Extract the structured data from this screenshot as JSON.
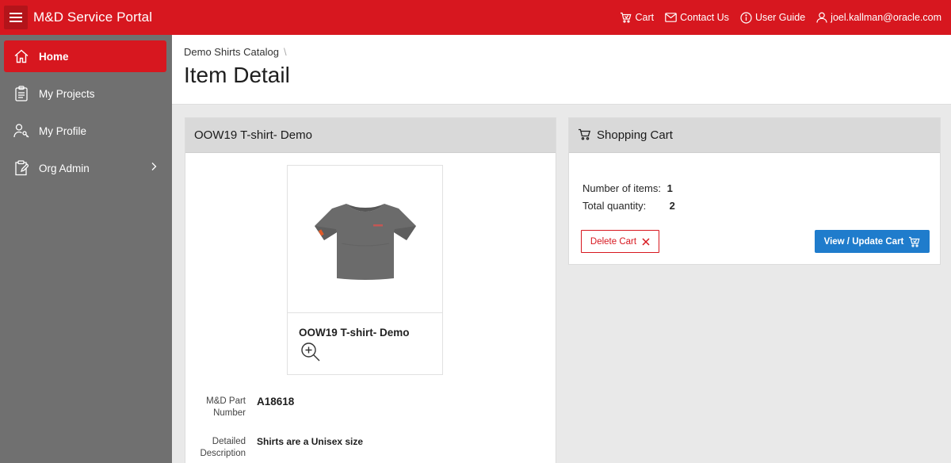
{
  "header": {
    "app_title": "M&D Service Portal",
    "nav": [
      {
        "label": "Cart",
        "icon": "cart-icon"
      },
      {
        "label": "Contact Us",
        "icon": "envelope-icon"
      },
      {
        "label": "User Guide",
        "icon": "info-icon"
      },
      {
        "label": "joel.kallman@oracle.com",
        "icon": "user-icon"
      }
    ],
    "brand_color": "#d7171f"
  },
  "sidebar": {
    "items": [
      {
        "label": "Home",
        "icon": "home-icon",
        "active": true
      },
      {
        "label": "My Projects",
        "icon": "clipboard-icon"
      },
      {
        "label": "My Profile",
        "icon": "user-key-icon"
      },
      {
        "label": "Org Admin",
        "icon": "clipboard-edit-icon",
        "has_children": true
      }
    ]
  },
  "page": {
    "breadcrumb": "Demo Shirts Catalog",
    "title": "Item Detail"
  },
  "item": {
    "region_title": "OOW19 T-shirt- Demo",
    "card_name": "OOW19 T-shirt- Demo",
    "fields": [
      {
        "label": "M&D Part Number",
        "value": "A18618"
      },
      {
        "label": "Detailed Description",
        "value": "Shirts are a Unisex size"
      }
    ]
  },
  "cart": {
    "region_title": "Shopping Cart",
    "items_label": "Number of items:",
    "items_value": "1",
    "qty_label": "Total quantity:",
    "qty_value": "2",
    "delete_label": "Delete Cart",
    "view_label": "View / Update Cart",
    "primary_color": "#1f7ccc"
  }
}
